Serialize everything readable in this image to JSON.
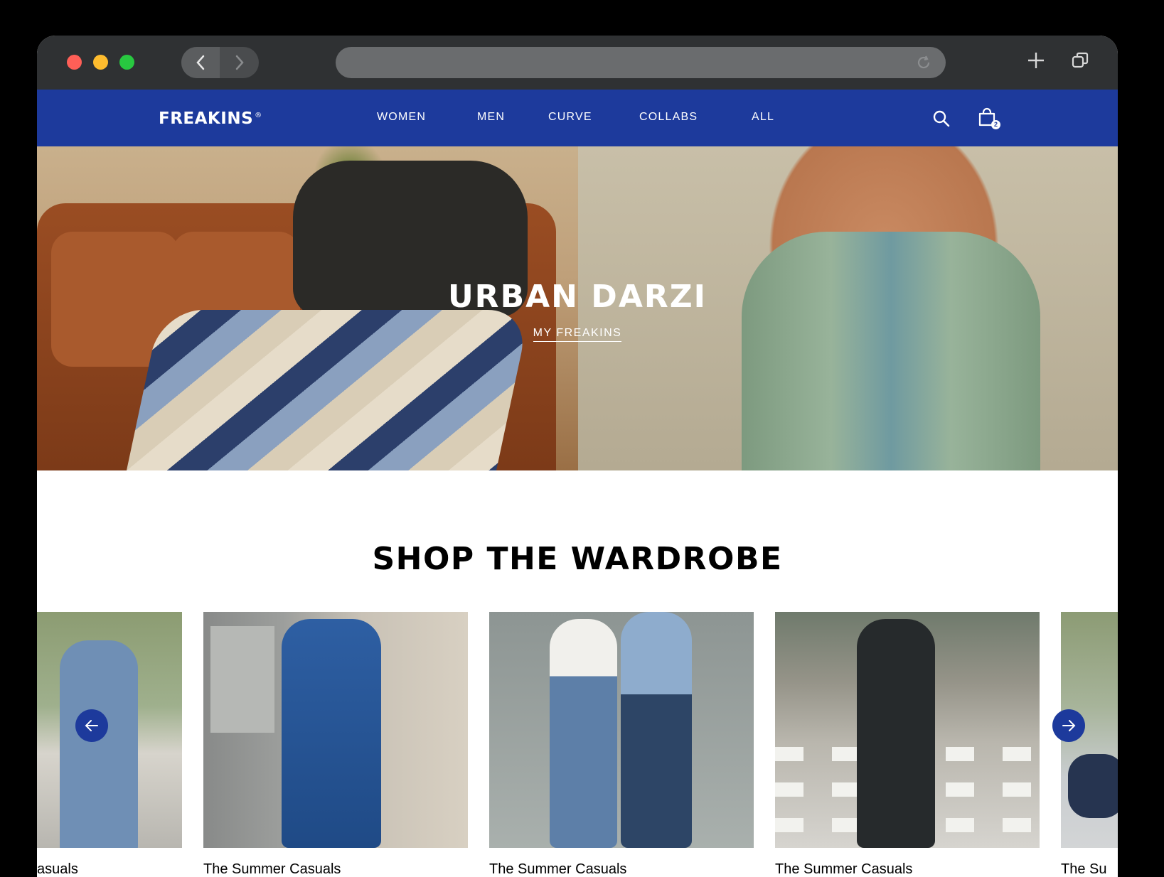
{
  "browser": {
    "window_controls": [
      "close",
      "minimize",
      "maximize"
    ],
    "icons": {
      "back": "chevron-left-icon",
      "forward": "chevron-right-icon",
      "reload": "reload-icon",
      "new_tab": "plus-icon",
      "tabs": "tabs-icon"
    }
  },
  "header": {
    "logo": "FREAKINS",
    "logo_mark": "®",
    "nav": [
      "WOMEN",
      "MEN",
      "CURVE",
      "COLLABS",
      "ALL"
    ],
    "cart_count": "2",
    "brand_color": "#1d3a9c"
  },
  "hero": {
    "title": "URBAN DARZI",
    "link": "MY FREAKINS"
  },
  "section": {
    "title": "SHOP THE WARDROBE"
  },
  "carousel": {
    "cards": [
      {
        "caption": "asuals"
      },
      {
        "caption": "The Summer Casuals"
      },
      {
        "caption": "The Summer Casuals"
      },
      {
        "caption": "The Summer Casuals"
      },
      {
        "caption": "The Su"
      }
    ],
    "prev_icon": "arrow-left-icon",
    "next_icon": "arrow-right-icon"
  }
}
